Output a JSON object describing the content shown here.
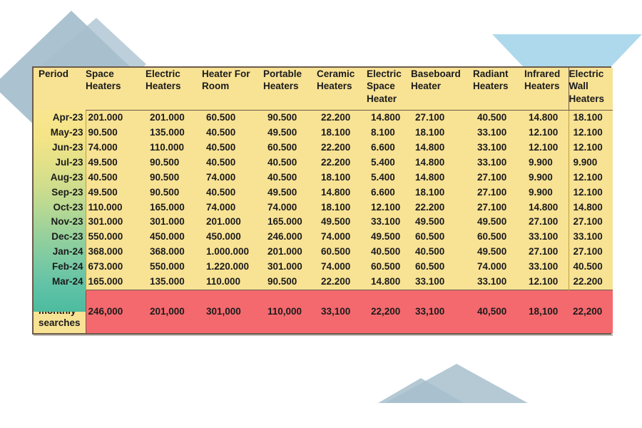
{
  "table": {
    "headers": [
      "Period",
      "Space Heaters",
      "Electric Heaters",
      "Heater For Room",
      "Portable Heaters",
      "Ceramic Heaters",
      "Electric Space Heater",
      "Baseboard Heater",
      "Radiant Heaters",
      "Infrared Heaters",
      "Electric Wall Heaters"
    ],
    "rows": [
      {
        "period": "Apr-23",
        "values": [
          "201.000",
          "201.000",
          "60.500",
          "90.500",
          "22.200",
          "14.800",
          "27.100",
          "40.500",
          "14.800",
          "18.100"
        ]
      },
      {
        "period": "May-23",
        "values": [
          "90.500",
          "135.000",
          "40.500",
          "49.500",
          "18.100",
          "8.100",
          "18.100",
          "33.100",
          "12.100",
          "12.100"
        ]
      },
      {
        "period": "Jun-23",
        "values": [
          "74.000",
          "110.000",
          "40.500",
          "60.500",
          "22.200",
          "6.600",
          "14.800",
          "33.100",
          "12.100",
          "12.100"
        ]
      },
      {
        "period": "Jul-23",
        "values": [
          "49.500",
          "90.500",
          "40.500",
          "40.500",
          "22.200",
          "5.400",
          "14.800",
          "33.100",
          "9.900",
          "9.900"
        ]
      },
      {
        "period": "Aug-23",
        "values": [
          "40.500",
          "90.500",
          "74.000",
          "40.500",
          "18.100",
          "5.400",
          "14.800",
          "27.100",
          "9.900",
          "12.100"
        ]
      },
      {
        "period": "Sep-23",
        "values": [
          "49.500",
          "90.500",
          "40.500",
          "49.500",
          "14.800",
          "6.600",
          "18.100",
          "27.100",
          "9.900",
          "12.100"
        ]
      },
      {
        "period": "Oct-23",
        "values": [
          "110.000",
          "165.000",
          "74.000",
          "74.000",
          "18.100",
          "12.100",
          "22.200",
          "27.100",
          "14.800",
          "14.800"
        ]
      },
      {
        "period": "Nov-23",
        "values": [
          "301.000",
          "301.000",
          "201.000",
          "165.000",
          "49.500",
          "33.100",
          "49.500",
          "49.500",
          "27.100",
          "27.100"
        ]
      },
      {
        "period": "Dec-23",
        "values": [
          "550.000",
          "450.000",
          "450.000",
          "246.000",
          "74.000",
          "49.500",
          "60.500",
          "60.500",
          "33.100",
          "33.100"
        ]
      },
      {
        "period": "Jan-24",
        "values": [
          "368.000",
          "368.000",
          "1.000.000",
          "201.000",
          "60.500",
          "40.500",
          "40.500",
          "49.500",
          "27.100",
          "27.100"
        ]
      },
      {
        "period": "Feb-24",
        "values": [
          "673.000",
          "550.000",
          "1.220.000",
          "301.000",
          "74.000",
          "60.500",
          "60.500",
          "74.000",
          "33.100",
          "40.500"
        ]
      },
      {
        "period": "Mar-24",
        "values": [
          "165.000",
          "135.000",
          "110.000",
          "90.500",
          "22.200",
          "14.800",
          "33.100",
          "33.100",
          "12.100",
          "22.200"
        ]
      }
    ],
    "average_row": {
      "label": "Average monthly searches",
      "values": [
        "246,000",
        "201,000",
        "301,000",
        "110,000",
        "33,100",
        "22,200",
        "33,100",
        "40,500",
        "18,100",
        "22,200"
      ]
    }
  },
  "colors": {
    "table_background": "#f8e294",
    "average_row_background": "#f4696e",
    "table_border": "#6b5b4a",
    "decoration_blue": "#aed9ec",
    "decoration_slate": "#a7bfcd",
    "period_gradient_start": "#f9e68f",
    "period_gradient_end": "#4dbb9f"
  },
  "decorations": [
    {
      "name": "diamond-top-left-large",
      "shape": "rotated-square"
    },
    {
      "name": "diamond-top-left-small",
      "shape": "rotated-square"
    },
    {
      "name": "triangle-top-right",
      "shape": "down-triangle"
    },
    {
      "name": "triangle-bottom-large",
      "shape": "up-triangle"
    },
    {
      "name": "triangle-bottom-small",
      "shape": "up-triangle"
    }
  ]
}
